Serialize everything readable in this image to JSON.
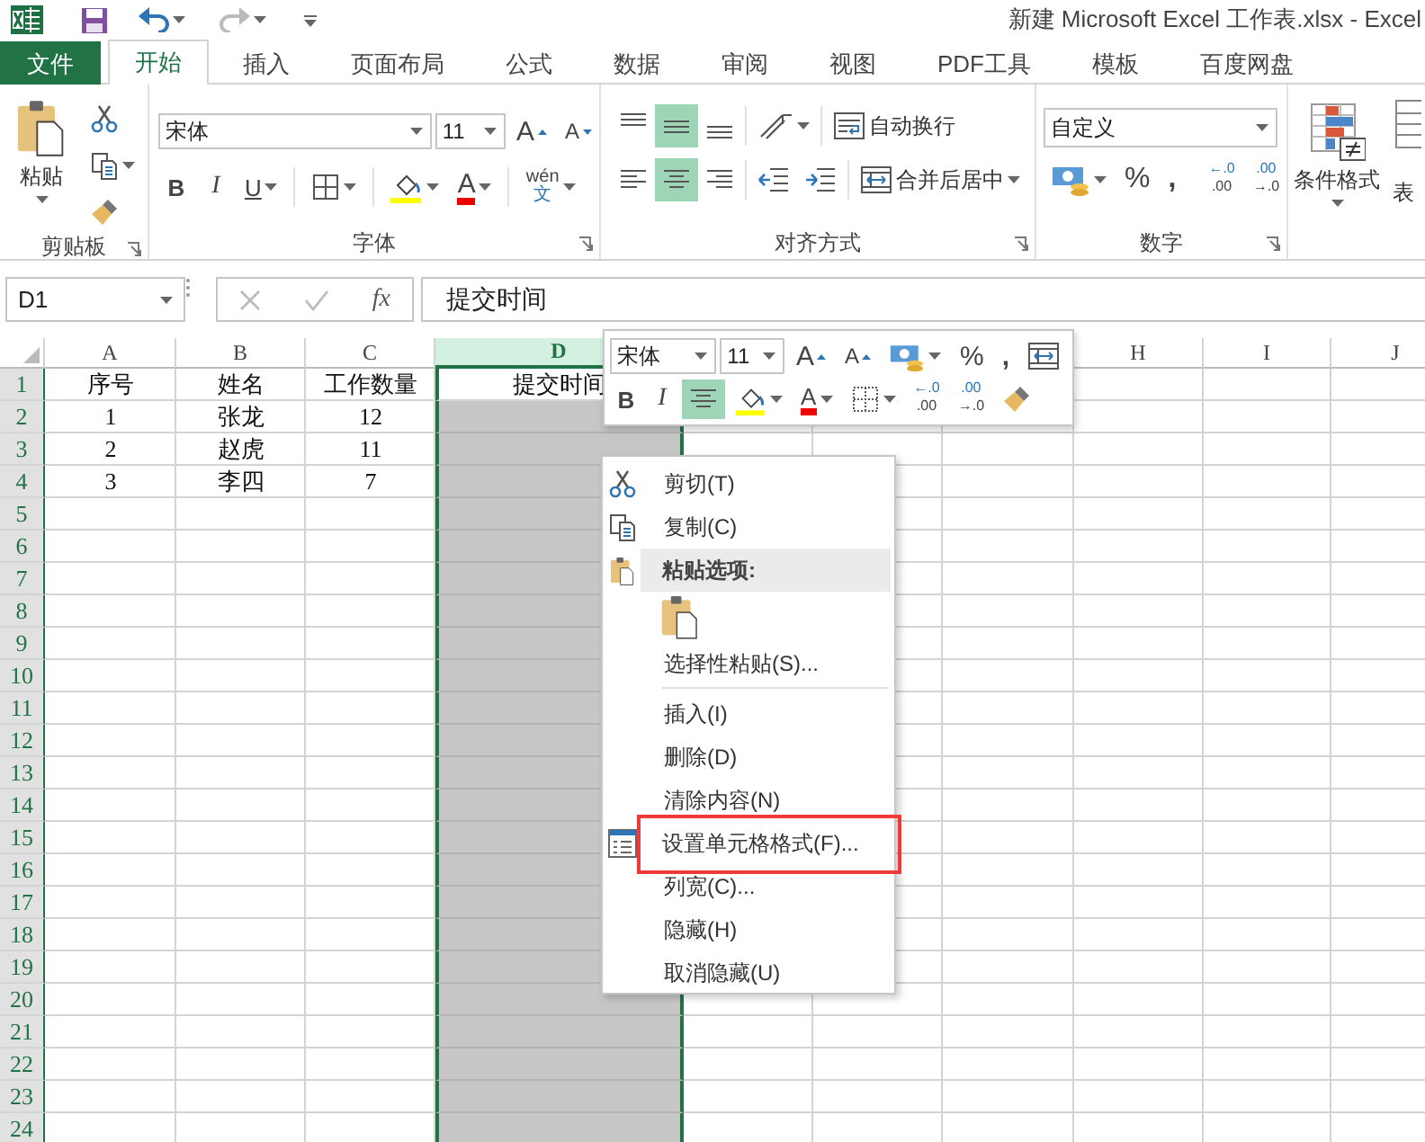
{
  "title_bar": {
    "title": "新建 Microsoft Excel 工作表.xlsx - Excel"
  },
  "ribbon_tabs": [
    {
      "label": "文件",
      "kind": "file",
      "selected": false
    },
    {
      "label": "开始",
      "kind": "tab",
      "selected": true
    },
    {
      "label": "插入",
      "kind": "tab",
      "selected": false
    },
    {
      "label": "页面布局",
      "kind": "tab",
      "selected": false
    },
    {
      "label": "公式",
      "kind": "tab",
      "selected": false
    },
    {
      "label": "数据",
      "kind": "tab",
      "selected": false
    },
    {
      "label": "审阅",
      "kind": "tab",
      "selected": false
    },
    {
      "label": "视图",
      "kind": "tab",
      "selected": false
    },
    {
      "label": "PDF工具",
      "kind": "tab",
      "selected": false
    },
    {
      "label": "模板",
      "kind": "tab",
      "selected": false
    },
    {
      "label": "百度网盘",
      "kind": "tab",
      "selected": false
    }
  ],
  "ribbon": {
    "clipboard": {
      "paste_label": "粘贴",
      "group_label": "剪贴板"
    },
    "font": {
      "font_name": "宋体",
      "font_size": "11",
      "grow_label": "A",
      "shrink_label": "A",
      "bold": "B",
      "italic": "I",
      "underline": "U",
      "font_color_label": "A",
      "phonetic_top": "wén",
      "phonetic_bottom": "文",
      "group_label": "字体"
    },
    "alignment": {
      "vertical": [
        {
          "on": false
        },
        {
          "on": true
        },
        {
          "on": false
        }
      ],
      "horizontal": [
        {
          "on": false
        },
        {
          "on": true
        },
        {
          "on": false
        }
      ],
      "wrap_text": "自动换行",
      "merge_center": "合并后居中",
      "group_label": "对齐方式"
    },
    "number": {
      "format": "自定义",
      "percent": "%",
      "comma": ",",
      "increase_decimal": [
        "←.0",
        ".00"
      ],
      "decrease_decimal": [
        ".00",
        "→.0"
      ],
      "group_label": "数字"
    },
    "styles": {
      "conditional_formatting": "条件格式",
      "cut_label": "表"
    }
  },
  "formula_bar": {
    "name_box": "D1",
    "fx": "fx",
    "formula": "提交时间"
  },
  "sheet": {
    "columns": [
      {
        "label": "A",
        "selected": false
      },
      {
        "label": "B",
        "selected": false
      },
      {
        "label": "C",
        "selected": false
      },
      {
        "label": "D",
        "selected": true
      },
      {},
      {},
      {},
      {
        "label": "H",
        "selected": false
      },
      {
        "label": "I",
        "selected": false
      },
      {
        "label": "J",
        "selected": false
      }
    ],
    "rows": [
      {
        "header": "1",
        "cells": [
          "序号",
          "姓名",
          "工作数量",
          "提交时间"
        ]
      },
      {
        "header": "2",
        "cells": [
          "1",
          "张龙",
          "12"
        ]
      },
      {
        "header": "3",
        "cells": [
          "2",
          "赵虎",
          "11"
        ]
      },
      {
        "header": "4",
        "cells": [
          "3",
          "李四",
          "7"
        ]
      },
      {
        "header": "5"
      },
      {
        "header": "6"
      },
      {
        "header": "7"
      },
      {
        "header": "8"
      },
      {
        "header": "9"
      },
      {
        "header": "10"
      },
      {
        "header": "11"
      },
      {
        "header": "12"
      },
      {
        "header": "13"
      },
      {
        "header": "14"
      },
      {
        "header": "15"
      },
      {
        "header": "16"
      },
      {
        "header": "17"
      },
      {
        "header": "18"
      },
      {
        "header": "19"
      },
      {
        "header": "20"
      },
      {
        "header": "21"
      },
      {
        "header": "22"
      },
      {
        "header": "23"
      },
      {
        "header": "24"
      }
    ]
  },
  "mini_toolbar": {
    "font_name": "宋体",
    "font_size": "11",
    "grow_label": "A",
    "shrink_label": "A",
    "percent": "%",
    "comma": ",",
    "bold": "B",
    "italic": "I",
    "center_on": true,
    "font_color_label": "A",
    "increase_decimal": [
      "←.0",
      ".00"
    ],
    "decrease_decimal": [
      ".00",
      "→.0"
    ]
  },
  "context_menu": {
    "items": [
      {
        "kind": "scissors",
        "label": "剪切(T)",
        "highlighted": false
      },
      {
        "kind": "copy",
        "label": "复制(C)",
        "highlighted": false
      },
      {
        "kind": "header",
        "label": "粘贴选项:"
      },
      {
        "kind": "paste"
      },
      {
        "kind": "plain",
        "label": "选择性粘贴(S)...",
        "highlighted": false
      },
      {
        "kind": "separator"
      },
      {
        "kind": "plain",
        "label": "插入(I)",
        "highlighted": false
      },
      {
        "kind": "plain",
        "label": "删除(D)",
        "highlighted": false
      },
      {
        "kind": "plain",
        "label": "清除内容(N)",
        "highlighted": false
      },
      {
        "kind": "format",
        "label": "设置单元格格式(F)...",
        "highlighted": true
      },
      {
        "kind": "plain",
        "label": "列宽(C)...",
        "highlighted": false
      },
      {
        "kind": "plain",
        "label": "隐藏(H)",
        "highlighted": false
      },
      {
        "kind": "plain",
        "label": "取消隐藏(U)",
        "highlighted": false
      }
    ]
  }
}
